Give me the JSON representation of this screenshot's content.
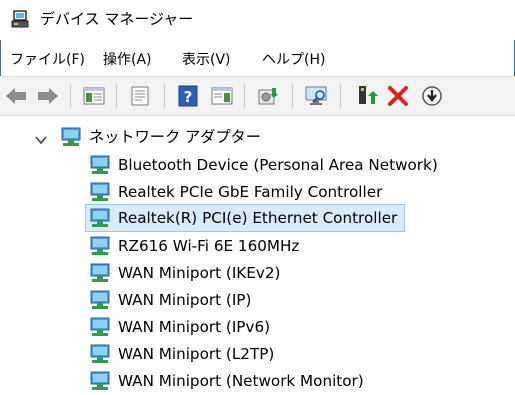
{
  "window": {
    "title": "デバイス マネージャー",
    "icon": "device-manager-icon"
  },
  "menu": {
    "items": [
      "ファイル(F)",
      "操作(A)",
      "表示(V)",
      "ヘルプ(H)"
    ]
  },
  "toolbar": {
    "buttons": [
      "back-arrow-icon",
      "forward-arrow-icon",
      "console-tree-icon",
      "properties-icon",
      "help-icon",
      "action-pane-icon",
      "update-driver-icon",
      "scan-hardware-icon",
      "enable-device-icon",
      "uninstall-device-icon",
      "disable-device-icon"
    ]
  },
  "tree": {
    "category": {
      "label": "ネットワーク アダプター",
      "expanded": true
    },
    "devices": [
      {
        "label": "Bluetooth Device (Personal Area Network)",
        "selected": false
      },
      {
        "label": "Realtek PCIe GbE Family Controller",
        "selected": false
      },
      {
        "label": "Realtek(R) PCI(e) Ethernet Controller",
        "selected": true
      },
      {
        "label": "RZ616 Wi-Fi 6E 160MHz",
        "selected": false
      },
      {
        "label": "WAN Miniport (IKEv2)",
        "selected": false
      },
      {
        "label": "WAN Miniport (IP)",
        "selected": false
      },
      {
        "label": "WAN Miniport (IPv6)",
        "selected": false
      },
      {
        "label": "WAN Miniport (L2TP)",
        "selected": false
      },
      {
        "label": "WAN Miniport (Network Monitor)",
        "selected": false
      }
    ]
  },
  "colors": {
    "accent_frame": "#3c6ea8",
    "selection_bg": "#d9ebfb",
    "selection_border": "#99c9ef",
    "delete_red": "#e01e1e",
    "green_arrow": "#1e9e3a"
  }
}
